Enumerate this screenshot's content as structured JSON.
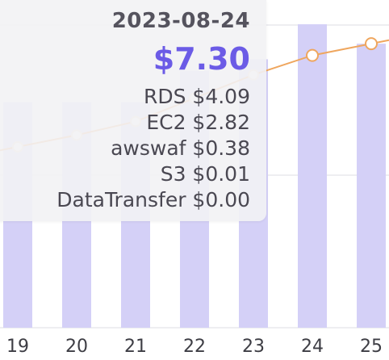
{
  "chart_data": {
    "type": "bar",
    "categories": [
      "19",
      "20",
      "21",
      "22",
      "23",
      "24",
      "25"
    ],
    "series": [
      {
        "values": [
          5.8,
          5.8,
          5.8,
          6.6,
          6.9,
          7.8,
          7.3
        ]
      },
      {
        "values": [
          4.65,
          4.95,
          5.3,
          5.9,
          6.5,
          7.0,
          7.3
        ]
      }
    ],
    "grid": true,
    "bar_color": "#d4d0f7",
    "line_color": "#efa65e",
    "grid_color": "#dcdce3",
    "tooltip": {
      "date": "2023-08-24",
      "total": "$7.30",
      "rows": [
        "RDS $4.09",
        "EC2 $2.82",
        "awswaf $0.38",
        "S3 $0.01",
        "DataTransfer $0.00"
      ]
    }
  }
}
